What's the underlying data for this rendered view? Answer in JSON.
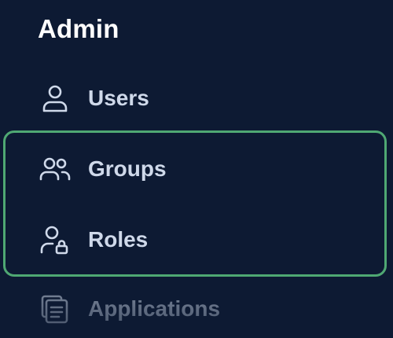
{
  "sidebar": {
    "section_title": "Admin",
    "items": [
      {
        "label": "Users",
        "icon": "user-icon"
      },
      {
        "label": "Groups",
        "icon": "users-group-icon"
      },
      {
        "label": "Roles",
        "icon": "user-lock-icon"
      },
      {
        "label": "Applications",
        "icon": "stacked-documents-icon"
      }
    ]
  },
  "colors": {
    "background": "#0d1a33",
    "title": "#ffffff",
    "item_text": "#cfd9ea",
    "focus_outline": "#4fa873"
  }
}
